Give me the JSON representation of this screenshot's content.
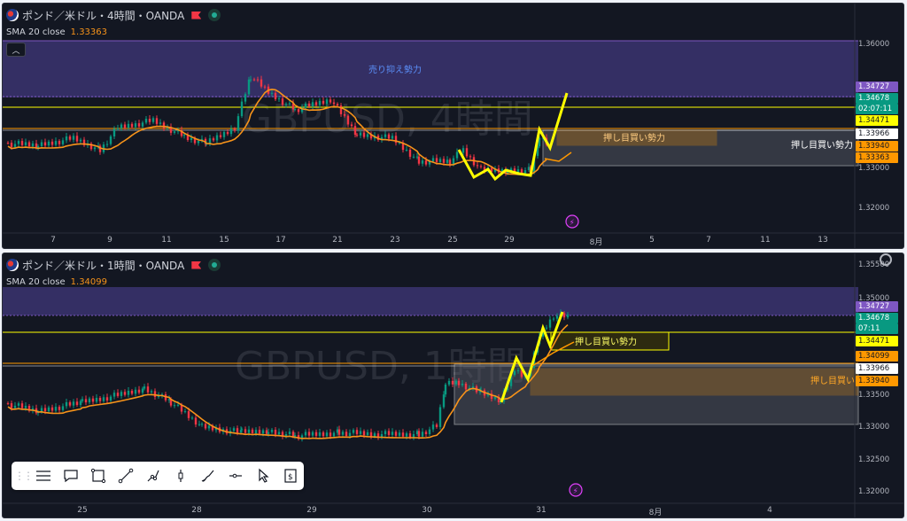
{
  "top": {
    "title": "ポンド／米ドル・4時間・OANDA",
    "sma_label": "SMA 20 close",
    "sma_value": "1.33363",
    "watermark": "GBPUSD, 4時間",
    "zone_upper_label": "売り抑え勢力",
    "zone_mid_label": "押し目買い勢力",
    "zone_right_label": "押し目買い勢力",
    "axis": [
      "1.36000",
      "1.33000",
      "1.32000"
    ],
    "price_labels": [
      {
        "text": "1.34727",
        "bg": "#7e57c2",
        "fg": "#ffffff"
      },
      {
        "text": "1.34678",
        "bg": "#089981",
        "fg": "#ffffff"
      },
      {
        "text": "02:07:11",
        "bg": "#089981",
        "fg": "#ffffff"
      },
      {
        "text": "1.34471",
        "bg": "#ffff00",
        "fg": "#131722"
      },
      {
        "text": "1.33966",
        "bg": "#ffffff",
        "fg": "#131722"
      },
      {
        "text": "1.33940",
        "bg": "#ff9800",
        "fg": "#131722"
      },
      {
        "text": "1.33363",
        "bg": "#ff9800",
        "fg": "#131722"
      }
    ],
    "time_labels": [
      "7",
      "9",
      "11",
      "15",
      "17",
      "21",
      "23",
      "25",
      "29",
      "8月",
      "5",
      "7",
      "11",
      "13"
    ]
  },
  "bottom": {
    "title": "ポンド／米ドル・1時間・OANDA",
    "sma_label": "SMA 20 close",
    "sma_value": "1.34099",
    "watermark": "GBPUSD, 1時間",
    "zone_mid_label": "押し目買い勢力",
    "zone_right_label": "押し目買い",
    "axis": [
      "1.35500",
      "1.35000",
      "1.33500",
      "1.33000",
      "1.32500",
      "1.32000"
    ],
    "price_labels": [
      {
        "text": "1.34727",
        "bg": "#7e57c2",
        "fg": "#ffffff"
      },
      {
        "text": "1.34678",
        "bg": "#089981",
        "fg": "#ffffff"
      },
      {
        "text": "07:11",
        "bg": "#089981",
        "fg": "#ffffff"
      },
      {
        "text": "1.34471",
        "bg": "#ffff00",
        "fg": "#131722"
      },
      {
        "text": "1.34099",
        "bg": "#ff9800",
        "fg": "#131722"
      },
      {
        "text": "1.33966",
        "bg": "#ffffff",
        "fg": "#131722"
      },
      {
        "text": "1.33940",
        "bg": "#ff9800",
        "fg": "#131722"
      }
    ],
    "time_labels": [
      "25",
      "28",
      "29",
      "30",
      "31",
      "8月",
      "4"
    ]
  },
  "toolbar": {
    "tools": [
      "lines-icon",
      "comment-icon",
      "rectangle-icon",
      "trendline-icon",
      "path-icon",
      "long-position-icon",
      "brush-icon",
      "horizontal-ray-icon",
      "cursor-icon",
      "price-range-icon"
    ]
  },
  "colors": {
    "bg": "#131722",
    "up": "#089981",
    "down": "#f23645",
    "sma": "#f7931a",
    "yellow": "#ffff00",
    "purple_zone": "#3b3470"
  }
}
